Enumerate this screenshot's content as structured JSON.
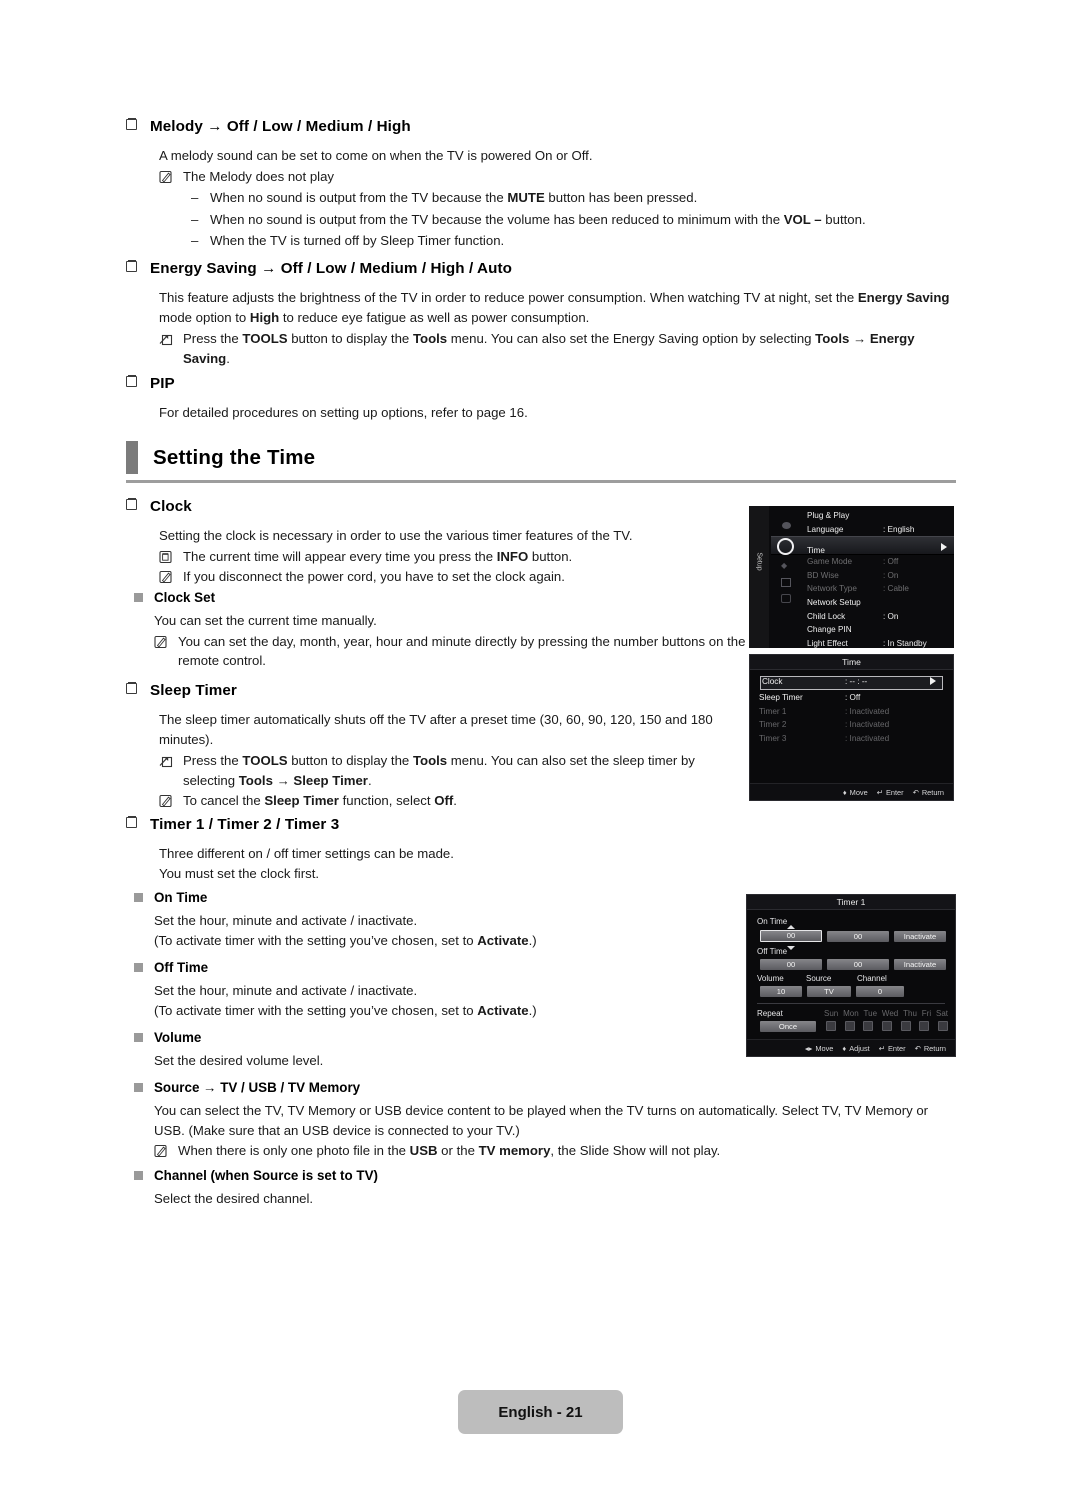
{
  "page": {
    "footer_label": "English - 21"
  },
  "sections": {
    "melody": {
      "heading": "Melody → Off / Low / Medium / High",
      "intro": "A melody sound can be set to come on when the TV is powered On or Off.",
      "note": "The Melody does not play",
      "dashes": [
        "When no sound is output from the TV because the MUTE button has been pressed.",
        "When no sound is output from the TV because the volume has been reduced to minimum with the VOL – button.",
        "When the TV is turned off by Sleep Timer function."
      ],
      "dash_mark": "–"
    },
    "energy_saving": {
      "heading": "Energy Saving → Off / Low / Medium / High / Auto",
      "body": "This feature adjusts the brightness of the TV in order to reduce power consumption. When watching TV at night, set the Energy Saving mode option to High to reduce eye fatigue as well as power consumption.",
      "note": "Press the TOOLS button to display the Tools menu. You can also set the Energy Saving option by selecting Tools → Energy Saving."
    },
    "pip": {
      "heading": "PIP",
      "body": "For detailed procedures on setting up options, refer to page 16."
    },
    "setting_the_time": {
      "title": "Setting the Time",
      "clock": {
        "heading": "Clock",
        "intro": "Setting the clock is necessary in order to use the various timer features of the TV.",
        "note1": "The current time will appear every time you press the INFO button.",
        "note2": "If you disconnect the power cord, you have to set the clock again."
      },
      "clock_set": {
        "heading": "Clock Set",
        "body": "You can set the current time manually.",
        "note": "You can set the day, month, year, hour and minute directly by pressing the number buttons on the remote control."
      },
      "sleep_timer": {
        "heading": "Sleep Timer",
        "body": "The sleep timer automatically shuts off the TV after a preset time (30, 60, 90, 120, 150 and 180 minutes).",
        "note1": "Press the TOOLS button to display the Tools menu. You can also set the sleep timer by selecting Tools → Sleep Timer.",
        "note2": "To cancel the Sleep Timer function, select Off."
      },
      "timers": {
        "heading": "Timer 1 / Timer 2 / Timer 3",
        "line1": "Three different on / off timer settings can be made.",
        "line2": "You must set the clock first."
      },
      "on_time": {
        "heading": "On Time",
        "line1": "Set the hour, minute and activate / inactivate.",
        "line2": "(To activate timer with the setting you’ve chosen, set to Activate.)"
      },
      "off_time": {
        "heading": "Off Time",
        "line1": "Set the hour, minute and activate / inactivate.",
        "line2": "(To activate timer with the setting you’ve chosen, set to Activate.)"
      },
      "volume": {
        "heading": "Volume",
        "line1": "Set the desired volume level."
      },
      "source": {
        "heading": "Source → TV / USB / TV Memory",
        "line1": "You can select the TV, TV Memory or USB device content to be played when the TV turns on automatically. Select TV, TV Memory or USB. (Make sure that an USB device is connected to your TV.)",
        "note": "When there is only one photo file in the USB or the TV memory, the Slide Show will not play."
      },
      "channel": {
        "heading": "Channel (when Source is set to TV)",
        "line1": "Select the desired channel."
      }
    }
  },
  "osd_setup": {
    "tab_label": "Setup",
    "items": [
      {
        "label": "Plug & Play",
        "value": ""
      },
      {
        "label": "Language",
        "value": ": English"
      },
      {
        "label": "Time",
        "value": ""
      },
      {
        "label": "Game Mode",
        "value": ": Off"
      },
      {
        "label": "BD Wise",
        "value": ": On"
      },
      {
        "label": "Network Type",
        "value": ": Cable"
      },
      {
        "label": "Network Setup",
        "value": ""
      },
      {
        "label": "Child Lock",
        "value": ": On"
      },
      {
        "label": "Change PIN",
        "value": ""
      },
      {
        "label": "Light Effect",
        "value": ": In Standby"
      }
    ]
  },
  "osd_time": {
    "title": "Time",
    "rows": [
      {
        "label": "Clock",
        "value": ": -- : --"
      },
      {
        "label": "Sleep Timer",
        "value": ": Off"
      },
      {
        "label": "Timer 1",
        "value": ": Inactivated"
      },
      {
        "label": "Timer 2",
        "value": ": Inactivated"
      },
      {
        "label": "Timer 3",
        "value": ": Inactivated"
      }
    ],
    "footer": {
      "move": "Move",
      "enter": "Enter",
      "return": "Return"
    }
  },
  "osd_timer": {
    "title": "Timer 1",
    "on_time_label": "On Time",
    "off_time_label": "Off Time",
    "on_time": {
      "hour": "00",
      "minute": "00",
      "state": "Inactivate"
    },
    "off_time": {
      "hour": "00",
      "minute": "00",
      "state": "Inactivate"
    },
    "volume_label": "Volume",
    "source_label": "Source",
    "channel_label": "Channel",
    "volume_value": "10",
    "source_value": "TV",
    "channel_value": "0",
    "repeat_label": "Repeat",
    "repeat_value": "Once",
    "days": [
      "Sun",
      "Mon",
      "Tue",
      "Wed",
      "Thu",
      "Fri",
      "Sat"
    ],
    "footer": {
      "move": "Move",
      "adjust": "Adjust",
      "enter": "Enter",
      "return": "Return"
    }
  }
}
